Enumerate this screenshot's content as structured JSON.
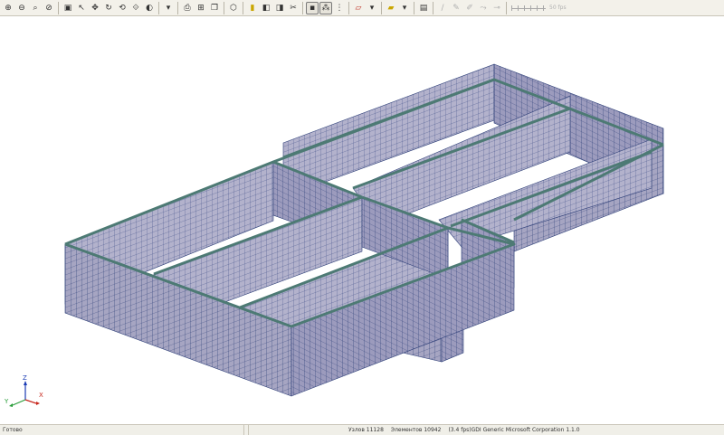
{
  "toolbar": {
    "buttons": [
      {
        "glyph": "⊕",
        "icon": "zoom-in-icon"
      },
      {
        "glyph": "⊖",
        "icon": "zoom-out-icon"
      },
      {
        "glyph": "⌕",
        "icon": "zoom-window-icon"
      },
      {
        "glyph": "⊘",
        "icon": "zoom-all-icon"
      },
      {
        "glyph": "▣",
        "icon": "zoom-extents-icon"
      },
      {
        "glyph": "↖",
        "icon": "select-arrow-icon"
      },
      {
        "glyph": "✥",
        "icon": "pan-icon"
      },
      {
        "glyph": "↻",
        "icon": "rotate-icon"
      },
      {
        "glyph": "⟲",
        "icon": "rotate-view-icon"
      },
      {
        "glyph": "⟐",
        "icon": "orbit-icon"
      },
      {
        "glyph": "◐",
        "icon": "view-mode-icon"
      },
      {
        "glyph": "▾",
        "icon": "chevron-down-icon"
      },
      {
        "glyph": "⎙",
        "icon": "print-icon"
      },
      {
        "glyph": "⊞",
        "icon": "fragment-icon"
      },
      {
        "glyph": "❐",
        "icon": "copy-icon"
      },
      {
        "glyph": "⬡",
        "icon": "iso-view-icon"
      },
      {
        "glyph": "▮",
        "icon": "yellow-solid-icon"
      },
      {
        "glyph": "◧",
        "icon": "shaded-icon"
      },
      {
        "glyph": "◨",
        "icon": "shaded-edges-icon"
      },
      {
        "glyph": "✂",
        "icon": "cut-icon"
      },
      {
        "glyph": "▪",
        "icon": "node-display-icon"
      },
      {
        "glyph": "⁂",
        "icon": "elements-display-icon"
      },
      {
        "glyph": "⋮",
        "icon": "numbering-icon"
      },
      {
        "glyph": "▱",
        "icon": "red-pencil-icon"
      },
      {
        "glyph": "▾",
        "icon": "chevron-down-icon"
      },
      {
        "glyph": "▰",
        "icon": "yellow-pencil-icon"
      },
      {
        "glyph": "▾",
        "icon": "chevron-down-icon"
      },
      {
        "glyph": "▤",
        "icon": "layers-icon"
      },
      {
        "glyph": "∕",
        "icon": "disabled-tool-1-icon"
      },
      {
        "glyph": "✎",
        "icon": "disabled-tool-2-icon"
      },
      {
        "glyph": "✐",
        "icon": "disabled-tool-3-icon"
      },
      {
        "glyph": "⤳",
        "icon": "disabled-tool-4-icon"
      },
      {
        "glyph": "⊸",
        "icon": "disabled-tool-5-icon"
      }
    ],
    "slider_readout": "50 fps"
  },
  "axes": {
    "z": "Z",
    "y": "Y",
    "x": "X",
    "z_color": "#1a3bb5",
    "y_color": "#2a9d3a",
    "x_color": "#c8281e"
  },
  "status": {
    "ready": "Готово",
    "nodes": "Узлов 11128",
    "elements": "Элементов 10942",
    "renderer": "(3.4 fps)GDI Generic Microsoft Corporation 1.1.0"
  },
  "colors": {
    "mesh_fill": "#a6a5c2",
    "mesh_line": "#2e3f78",
    "top_edge": "#4d7a74"
  }
}
